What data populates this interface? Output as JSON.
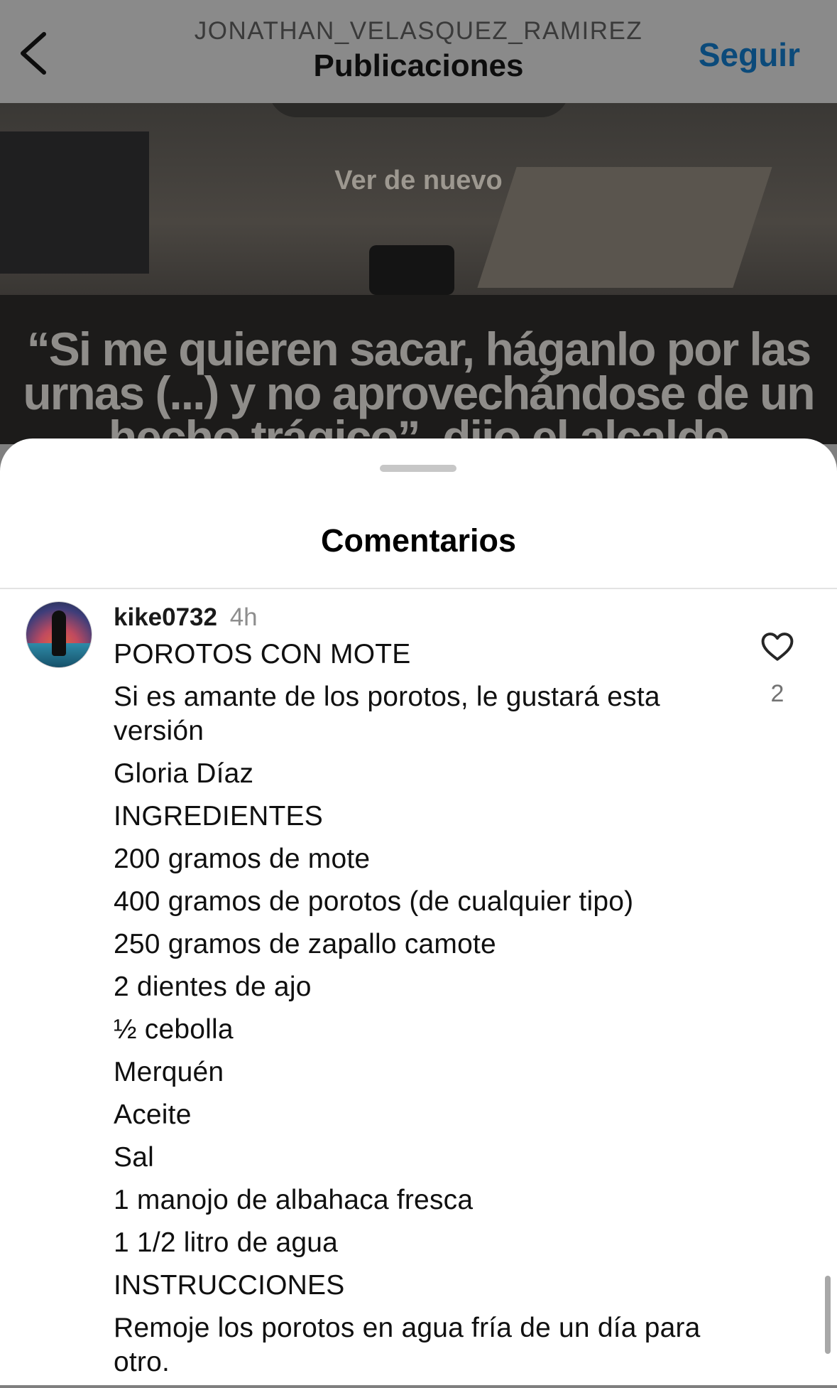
{
  "header": {
    "username": "JONATHAN_VELASQUEZ_RAMIREZ",
    "title": "Publicaciones",
    "follow_label": "Seguir",
    "back_icon": "chevron-left-icon"
  },
  "media": {
    "replay_label": "Ver de nuevo",
    "quote_text": "“Si me quieren sacar, háganlo por las urnas (...) y no aprovechándose de un hecho trágico”, dijo el alcalde"
  },
  "sheet": {
    "title": "Comentarios"
  },
  "comment": {
    "username": "kike0732",
    "time": "4h",
    "like_count": "2",
    "like_icon": "heart-icon",
    "lines": [
      "POROTOS CON MOTE",
      "Si es amante de los porotos, le gustará esta versión",
      "Gloria Díaz",
      "INGREDIENTES",
      "200 gramos de mote",
      "400 gramos de porotos (de cualquier tipo)",
      "250 gramos de zapallo camote",
      "2 dientes de ajo",
      "½ cebolla",
      "Merquén",
      "Aceite",
      "Sal",
      "1 manojo de albahaca fresca",
      "1 1/2 litro de agua",
      "INSTRUCCIONES",
      "Remoje los porotos en agua fría de un día para otro."
    ]
  },
  "colors": {
    "accent": "#0095f6",
    "text": "#000000",
    "muted": "#8e8e8e"
  }
}
